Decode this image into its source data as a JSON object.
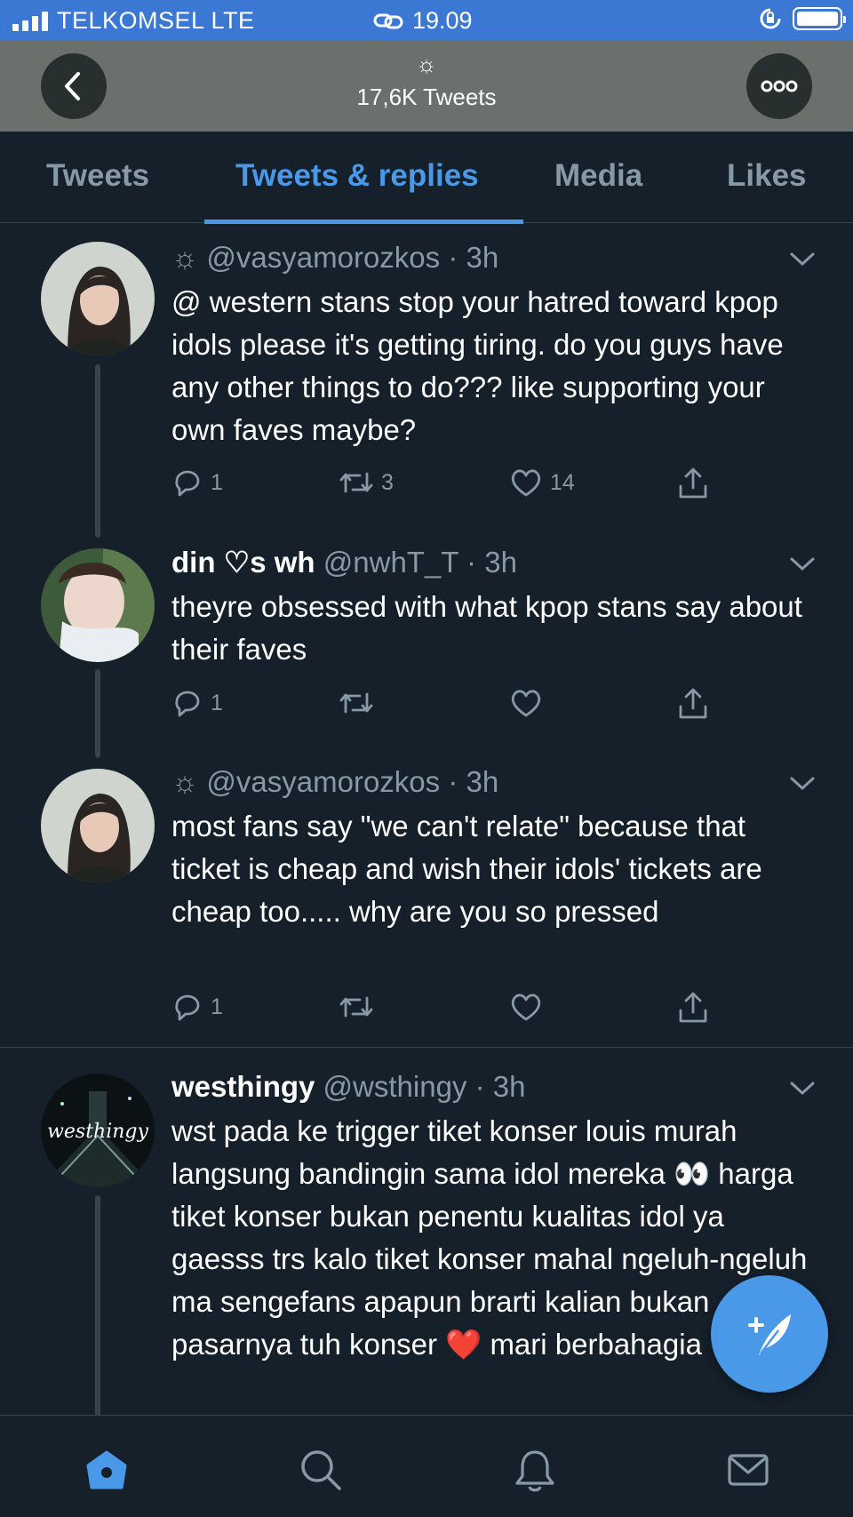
{
  "status_bar": {
    "carrier": "TELKOMSEL  LTE",
    "time": "19.09"
  },
  "header": {
    "sun_glyph": "☼",
    "tweet_count": "17,6K Tweets"
  },
  "tabs": [
    {
      "label": "Tweets",
      "active": false
    },
    {
      "label": "Tweets & replies",
      "active": true
    },
    {
      "label": "Media",
      "active": false
    },
    {
      "label": "Likes",
      "active": false
    }
  ],
  "tweets": [
    {
      "name": "",
      "sun": "☼",
      "handle": "@vasyamorozkos",
      "separator": "·",
      "time": "3h",
      "text": "@ western stans stop your hatred toward kpop idols please it's getting tiring. do you guys have any other things to do??? like supporting your own faves maybe?",
      "replies": "1",
      "retweets": "3",
      "likes": "14"
    },
    {
      "name": "din ♡s wh",
      "sun": "",
      "handle": "@nwhT_T",
      "separator": "·",
      "time": "3h",
      "text": "theyre obsessed with what kpop stans say about their faves",
      "replies": "1",
      "retweets": "",
      "likes": ""
    },
    {
      "name": "",
      "sun": "☼",
      "handle": "@vasyamorozkos",
      "separator": "·",
      "time": "3h",
      "text": "most fans say \"we can't relate\" because that ticket is cheap and wish their idols' tickets are cheap too..... why are you so pressed",
      "replies": "1",
      "retweets": "",
      "likes": ""
    },
    {
      "name": "westhingy",
      "sun": "",
      "handle": "@wsthingy",
      "separator": "·",
      "time": "3h",
      "avatar_text": "westhingy",
      "text": "wst pada ke trigger tiket konser louis murah langsung bandingin sama idol mereka 👀 harga tiket konser bukan penentu kualitas idol ya gaesss trs kalo tiket konser mahal ngeluh-ngeluh ma sengefans apapun brarti kalian bukan pasarnya tuh konser ❤️ mari berbahagia",
      "replies": "",
      "retweets": "",
      "likes": ""
    }
  ],
  "icons": {
    "reply": "reply-icon",
    "retweet": "retweet-icon",
    "like": "heart-icon",
    "share": "share-icon"
  },
  "colors": {
    "background": "#15202b",
    "accent": "#4a99e9",
    "muted": "#8899a6",
    "status_bar": "#3a78d4"
  }
}
